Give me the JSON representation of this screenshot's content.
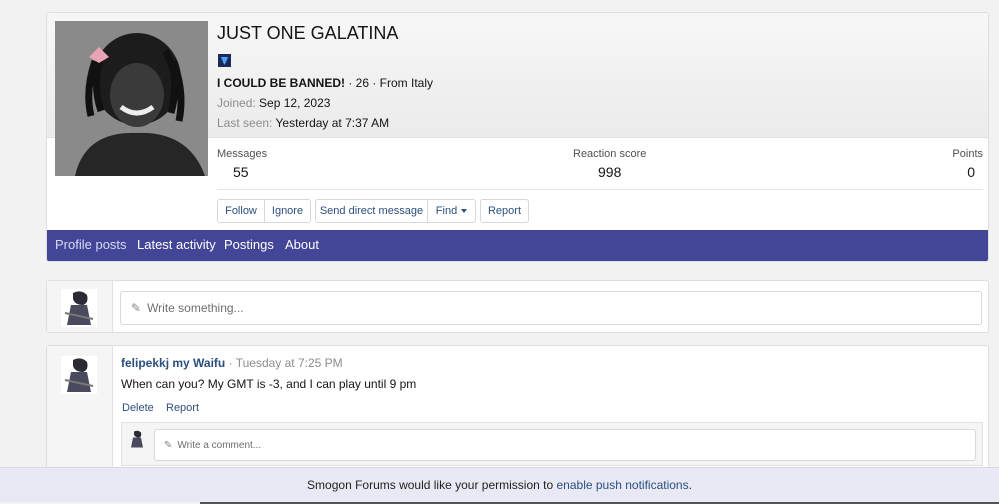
{
  "profile": {
    "name": "JUST ONE GALATINA",
    "title": "I COULD BE BANNED!",
    "age_location": " · 26 · From Italy",
    "joined_label": "Joined:",
    "joined_value": "Sep 12, 2023",
    "last_seen_label": "Last seen:",
    "last_seen_value": "Yesterday at 7:37 AM",
    "stats": [
      {
        "label": "Messages",
        "value": "55"
      },
      {
        "label": "Reaction score",
        "value": "998"
      },
      {
        "label": "Points",
        "value": "0"
      }
    ],
    "buttons": {
      "follow": "Follow",
      "ignore": "Ignore",
      "send_dm": "Send direct message",
      "find": "Find",
      "report": "Report"
    },
    "tabs": [
      "Profile posts",
      "Latest activity",
      "Postings",
      "About"
    ]
  },
  "composer": {
    "placeholder": "Write something..."
  },
  "post": {
    "user": "felipekkj my Waifu",
    "time": "Tuesday at 7:25 PM",
    "body": "When can you? My GMT is -3, and I can play until 9 pm",
    "delete": "Delete",
    "report": "Report",
    "comment_placeholder": "Write a comment..."
  },
  "notice": {
    "text": "Smogon Forums would like your permission to ",
    "link": "enable push notifications",
    "suffix": "."
  },
  "colors": {
    "tab_bar": "#434597",
    "link": "#2c4f7e"
  }
}
